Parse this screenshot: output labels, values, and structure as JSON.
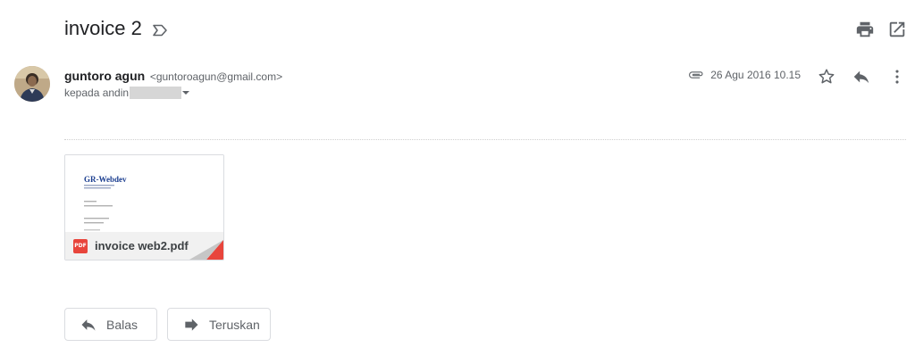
{
  "message": {
    "subject": "invoice 2",
    "sender_name": "guntoro agun",
    "sender_email": "<guntoroagun@gmail.com>",
    "recipient_prefix": "kepada andin",
    "date": "26 Agu 2016 10.15"
  },
  "attachment": {
    "filename": "invoice web2.pdf",
    "type_badge": "PDF",
    "preview": {
      "heading": "GR-Webdev"
    }
  },
  "actions": {
    "reply_label": "Balas",
    "forward_label": "Teruskan"
  },
  "icons": {
    "label": "label-outline-icon",
    "print": "print-icon",
    "open_new_window": "open-in-new-window-icon",
    "attachment": "paperclip-icon",
    "star": "star-icon",
    "reply": "reply-icon",
    "more": "more-vert-icon",
    "forward": "forward-icon"
  },
  "colors": {
    "pdf_red": "#e8453c",
    "preview_heading": "#1a3d8f",
    "icon_gray": "#5f6368"
  }
}
